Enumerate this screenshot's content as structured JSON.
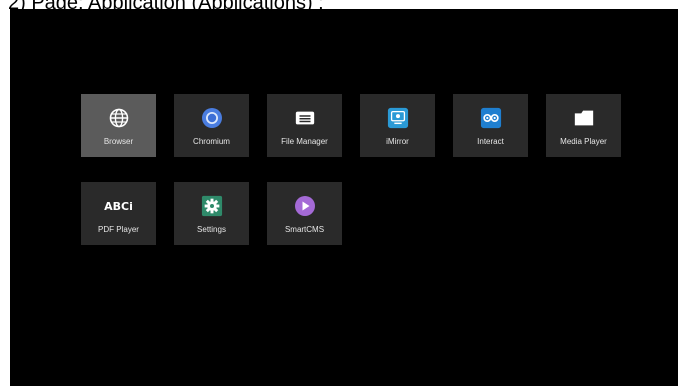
{
  "caption": "2) Page: Application (Applications) :",
  "colors": {
    "screen_bg": "#000000",
    "tile_bg": "#2a2a2a",
    "tile_selected_bg": "#5b5b5b",
    "chromium_blue": "#4a7de0",
    "imirror_blue": "#2a9ad6",
    "interact_blue": "#1f7fd0",
    "settings_green": "#2f8a6a",
    "smartcms_purple": "#a46ad6"
  },
  "apps": [
    {
      "label": "Browser",
      "icon": "globe-icon",
      "selected": true
    },
    {
      "label": "Chromium",
      "icon": "chromium-icon",
      "selected": false
    },
    {
      "label": "File Manager",
      "icon": "file-manager-icon",
      "selected": false
    },
    {
      "label": "iMirror",
      "icon": "imirror-icon",
      "selected": false
    },
    {
      "label": "Interact",
      "icon": "interact-icon",
      "selected": false
    },
    {
      "label": "Media Player",
      "icon": "folder-icon",
      "selected": false
    },
    {
      "label": "PDF Player",
      "icon": "pdf-abc-icon",
      "icon_text": "ABCi",
      "selected": false
    },
    {
      "label": "Settings",
      "icon": "gear-icon",
      "selected": false
    },
    {
      "label": "SmartCMS",
      "icon": "play-icon",
      "selected": false
    }
  ]
}
